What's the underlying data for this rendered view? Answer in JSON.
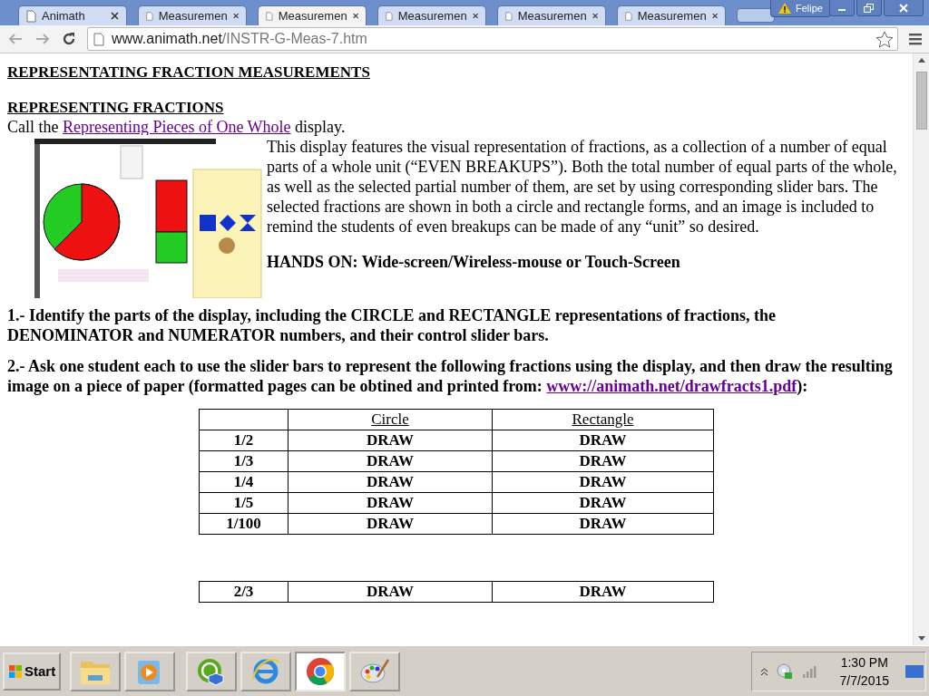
{
  "browser": {
    "tabs": [
      {
        "title": "Animath",
        "selected": false
      },
      {
        "title": "Measuremen",
        "selected": false
      },
      {
        "title": "Measuremen",
        "selected": true
      },
      {
        "title": "Measuremen",
        "selected": false
      },
      {
        "title": "Measuremen",
        "selected": false
      },
      {
        "title": "Measuremen",
        "selected": false
      }
    ],
    "user": "Felipe",
    "url": {
      "domain": "www.animath.net",
      "path": "/INSTR-G-Meas-7.htm"
    }
  },
  "page": {
    "title": "REPRESENTATING FRACTION MEASUREMENTS",
    "section": "REPRESENTING FRACTIONS",
    "intro": {
      "before": "Call the ",
      "link": "Representing Pieces of One Whole",
      "after": " display."
    },
    "paragraph": "This display features the visual representation of fractions, as a collection of a number of equal parts of a whole unit (“EVEN BREAKUPS”). Both the total number of equal parts of the whole, as well as the selected partial number of them, are set by using corresponding slider bars. The selected fractions are shown in both a circle and rectangle forms, and an image is included to remind the students of even breakups can be made of any “unit” so desired.",
    "hands_on": "HANDS ON:  Wide-screen/Wireless-mouse or Touch-Screen",
    "steps": [
      {
        "text": "1.- Identify the parts of the display, including the CIRCLE and RECTANGLE representations of fractions, the DENOMINATOR and NUMERATOR numbers, and their control slider bars."
      },
      {
        "text": "2.- Ask one student each to use the slider bars to represent the following fractions using the display, and then draw the resulting image on a piece of paper (formatted pages can be obtined and printed from: ",
        "link": "www://animath.net/drawfracts1.pdf",
        "after": "):"
      }
    ],
    "table": {
      "columns": [
        "",
        "Circle",
        "Rectangle"
      ],
      "rows": [
        [
          "1/2",
          "DRAW",
          "DRAW"
        ],
        [
          "1/3",
          "DRAW",
          "DRAW"
        ],
        [
          "1/4",
          "DRAW",
          "DRAW"
        ],
        [
          "1/5",
          "DRAW",
          "DRAW"
        ],
        [
          "1/100",
          "DRAW",
          "DRAW"
        ]
      ]
    },
    "table_2": {
      "rows": [
        [
          "2/3",
          "DRAW",
          "DRAW"
        ]
      ]
    }
  },
  "taskbar": {
    "start": "Start",
    "apps": [
      {
        "kind": "folder",
        "selected": false
      },
      {
        "kind": "media",
        "selected": false
      },
      {
        "kind": "green",
        "selected": false
      },
      {
        "kind": "ie",
        "selected": false
      },
      {
        "kind": "chrome",
        "selected": true
      },
      {
        "kind": "paint",
        "selected": false
      }
    ],
    "time": "1:30 PM",
    "date": "7/7/2015"
  }
}
